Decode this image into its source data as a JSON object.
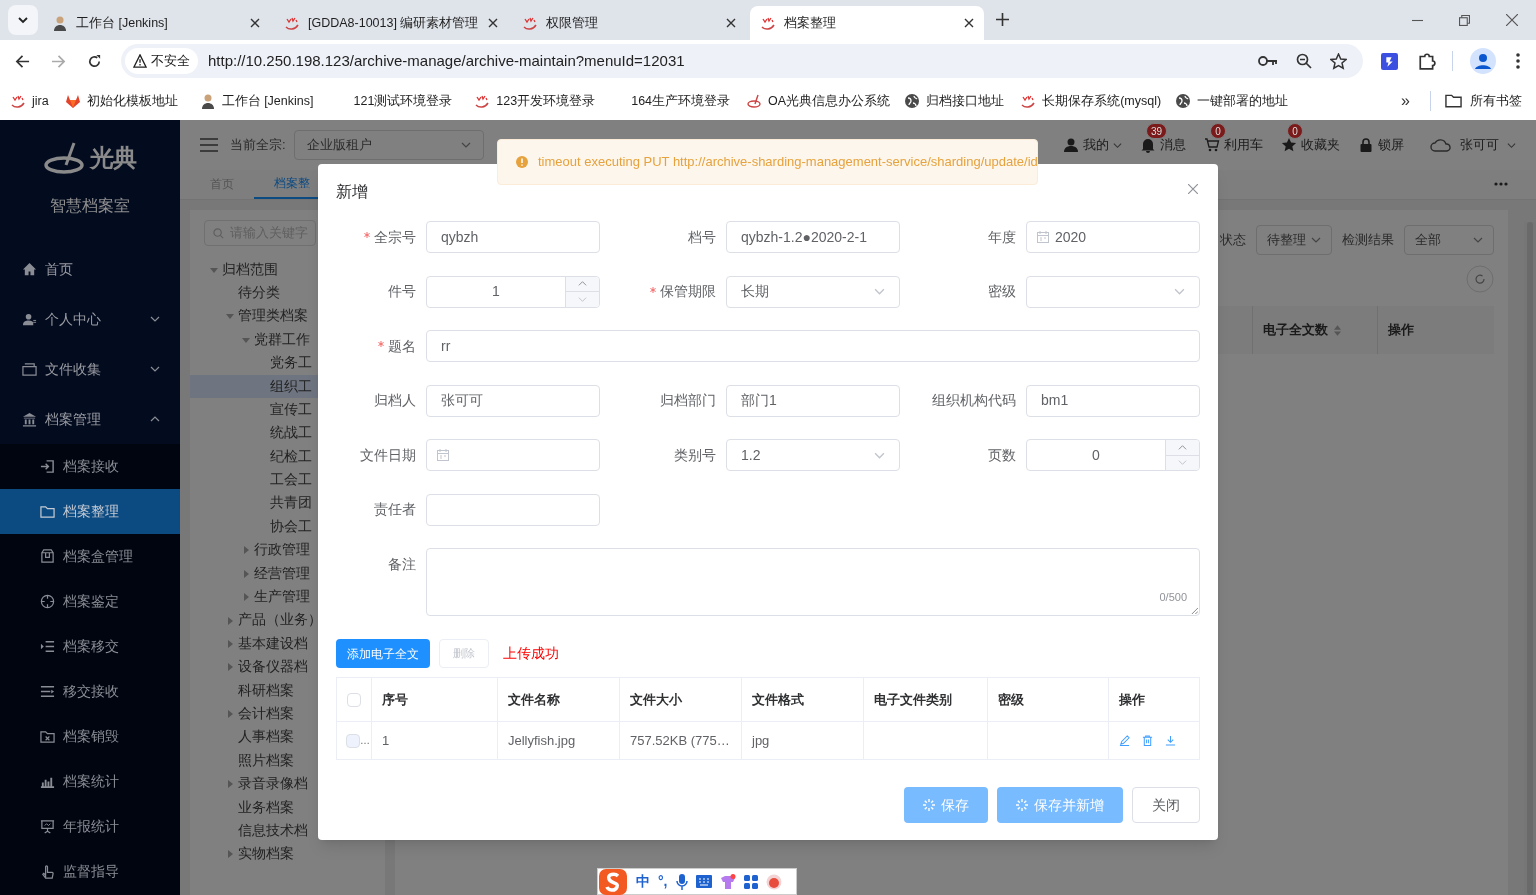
{
  "browser": {
    "tabs": [
      {
        "title": "工作台 [Jenkins]",
        "selected": false
      },
      {
        "title": "[GDDA8-10013] 编研素材管理",
        "selected": false
      },
      {
        "title": "权限管理",
        "selected": false
      },
      {
        "title": "档案整理",
        "selected": true
      }
    ],
    "security_label": "不安全",
    "url": "http://10.250.198.123/archive-manage/archive-maintain?menuId=12031",
    "bookmarks": [
      {
        "label": "jira"
      },
      {
        "label": "初始化模板地址"
      },
      {
        "label": "工作台 [Jenkins]"
      },
      {
        "label": "121测试环境登录"
      },
      {
        "label": "123开发环境登录"
      },
      {
        "label": "164生产环境登录"
      },
      {
        "label": "OA光典信息办公系统"
      },
      {
        "label": "归档接口地址"
      },
      {
        "label": "长期保存系统(mysql)"
      },
      {
        "label": "一键部署的地址"
      }
    ],
    "overflow": "»",
    "all_bookmarks": "所有书签"
  },
  "sidebar": {
    "logo_text": "光典",
    "subtitle": "智慧档案室",
    "items": [
      {
        "label": "首页",
        "kind": "link"
      },
      {
        "label": "个人中心",
        "kind": "group",
        "expanded": false
      },
      {
        "label": "文件收集",
        "kind": "group",
        "expanded": false
      },
      {
        "label": "档案管理",
        "kind": "group",
        "expanded": true,
        "children": [
          {
            "label": "档案接收",
            "selected": false
          },
          {
            "label": "档案整理",
            "selected": true
          },
          {
            "label": "档案盒管理",
            "selected": false
          },
          {
            "label": "档案鉴定",
            "selected": false
          },
          {
            "label": "档案移交",
            "selected": false
          },
          {
            "label": "移交接收",
            "selected": false
          },
          {
            "label": "档案销毁",
            "selected": false
          },
          {
            "label": "档案统计",
            "selected": false
          },
          {
            "label": "年报统计",
            "selected": false
          },
          {
            "label": "监督指导",
            "selected": false
          }
        ]
      }
    ]
  },
  "header": {
    "fonds_label": "当前全宗:",
    "fonds": "企业版租户",
    "actions": [
      {
        "kind": "menu",
        "label": "我的"
      },
      {
        "kind": "badge",
        "label": "消息",
        "badge": "39"
      },
      {
        "kind": "badge",
        "label": "利用车",
        "badge": "0"
      },
      {
        "kind": "badge",
        "label": "收藏夹",
        "badge": "0"
      },
      {
        "kind": "plain",
        "label": "锁屏"
      }
    ],
    "user": "张可可"
  },
  "page_tabs": [
    {
      "label": "首页",
      "selected": false
    },
    {
      "label": "档案整",
      "selected": true
    }
  ],
  "tree": {
    "placeholder": "请输入关键字",
    "nodes": [
      {
        "label": "归档范围",
        "kind": "branch",
        "expanded": true,
        "selected": false,
        "children": [
          {
            "label": "待分类",
            "kind": "leaf",
            "selected": false
          },
          {
            "label": "管理类档案",
            "kind": "branch",
            "expanded": true,
            "selected": false,
            "children": [
              {
                "label": "党群工作",
                "kind": "branch",
                "expanded": true,
                "selected": false,
                "children": [
                  {
                    "label": "党务工",
                    "kind": "leaf",
                    "selected": false
                  },
                  {
                    "label": "组织工",
                    "kind": "leaf",
                    "selected": true
                  },
                  {
                    "label": "宣传工",
                    "kind": "leaf",
                    "selected": false
                  },
                  {
                    "label": "统战工",
                    "kind": "leaf",
                    "selected": false
                  },
                  {
                    "label": "纪检工",
                    "kind": "leaf",
                    "selected": false
                  },
                  {
                    "label": "工会工",
                    "kind": "leaf",
                    "selected": false
                  },
                  {
                    "label": "共青团",
                    "kind": "leaf",
                    "selected": false
                  },
                  {
                    "label": "协会工",
                    "kind": "leaf",
                    "selected": false
                  }
                ]
              },
              {
                "label": "行政管理",
                "kind": "branch",
                "expanded": false,
                "selected": false
              },
              {
                "label": "经营管理",
                "kind": "branch",
                "expanded": false,
                "selected": false
              },
              {
                "label": "生产管理",
                "kind": "branch",
                "expanded": false,
                "selected": false
              }
            ]
          },
          {
            "label": "产品（业务）",
            "kind": "branch",
            "expanded": false,
            "selected": false
          },
          {
            "label": "基本建设档",
            "kind": "branch",
            "expanded": false,
            "selected": false
          },
          {
            "label": "设备仪器档",
            "kind": "branch",
            "expanded": false,
            "selected": false
          },
          {
            "label": "科研档案",
            "kind": "leaf",
            "selected": false
          },
          {
            "label": "会计档案",
            "kind": "branch",
            "expanded": false,
            "selected": false
          },
          {
            "label": "人事档案",
            "kind": "leaf",
            "selected": false
          },
          {
            "label": "照片档案",
            "kind": "leaf",
            "selected": false
          },
          {
            "label": "录音录像档",
            "kind": "branch",
            "expanded": false,
            "selected": false
          },
          {
            "label": "业务档案",
            "kind": "leaf",
            "selected": false
          },
          {
            "label": "信息技术档",
            "kind": "leaf",
            "selected": false
          },
          {
            "label": "实物档案",
            "kind": "branch",
            "expanded": false,
            "selected": false
          }
        ]
      }
    ]
  },
  "filters": [
    {
      "label": "状态",
      "value": "待整理"
    },
    {
      "label": "检测结果",
      "value": "全部"
    }
  ],
  "list_columns": [
    {
      "label": "电子全文数",
      "sortable": true
    },
    {
      "label": "操作",
      "sortable": false
    }
  ],
  "toast": {
    "kind": "warning",
    "message": "timeout executing PUT http://archive-sharding-management-service/sharding/update/id"
  },
  "dialog": {
    "title": "新增",
    "rows": [
      [
        {
          "label": "全宗号",
          "kind": "text",
          "value": "qybzh",
          "required": true
        },
        {
          "label": "档号",
          "kind": "text",
          "value": "qybzh-1.2●2020-2-1",
          "required": false
        },
        {
          "label": "年度",
          "kind": "date",
          "value": "2020",
          "required": false
        }
      ],
      [
        {
          "label": "件号",
          "kind": "number",
          "value": "1",
          "required": false
        },
        {
          "label": "保管期限",
          "kind": "select",
          "value": "长期",
          "required": true
        },
        {
          "label": "密级",
          "kind": "select",
          "required": false
        }
      ],
      [
        {
          "label": "题名",
          "kind": "long_text",
          "value": "rr",
          "required": true
        }
      ],
      [
        {
          "label": "归档人",
          "kind": "text",
          "value": "张可可",
          "required": false
        },
        {
          "label": "归档部门",
          "kind": "text",
          "value": "部门1",
          "required": false
        },
        {
          "label": "组织机构代码",
          "kind": "text",
          "value": "bm1",
          "required": false
        }
      ],
      [
        {
          "label": "文件日期",
          "kind": "date",
          "required": false
        },
        {
          "label": "类别号",
          "kind": "select",
          "value": "1.2",
          "required": false
        },
        {
          "label": "页数",
          "kind": "number",
          "value": "0",
          "required": false
        }
      ],
      [
        {
          "label": "责任者",
          "kind": "text",
          "required": false
        }
      ],
      [
        {
          "label": "备注",
          "kind": "textarea",
          "counter": "0/500",
          "required": false
        }
      ]
    ],
    "upload_button": "添加电子全文",
    "delete_button": {
      "label": "删除",
      "disabled": true
    },
    "upload_status": "上传成功",
    "table": {
      "header_checked": false,
      "columns": [
        "序号",
        "文件名称",
        "文件大小",
        "文件格式",
        "电子文件类别",
        "密级",
        "操作"
      ],
      "rows": [
        {
          "checked": false,
          "overflow": "…",
          "cells": [
            "1",
            "Jellyfish.jpg",
            "757.52KB (775…",
            "jpg",
            "",
            ""
          ]
        }
      ]
    },
    "buttons": [
      {
        "label": "保存",
        "kind": "primary",
        "loading": true
      },
      {
        "label": "保存并新增",
        "kind": "primary",
        "loading": true
      },
      {
        "label": "关闭",
        "kind": "default",
        "loading": false
      }
    ]
  },
  "ime_bar": {
    "items": [
      "中",
      "°,"
    ]
  }
}
